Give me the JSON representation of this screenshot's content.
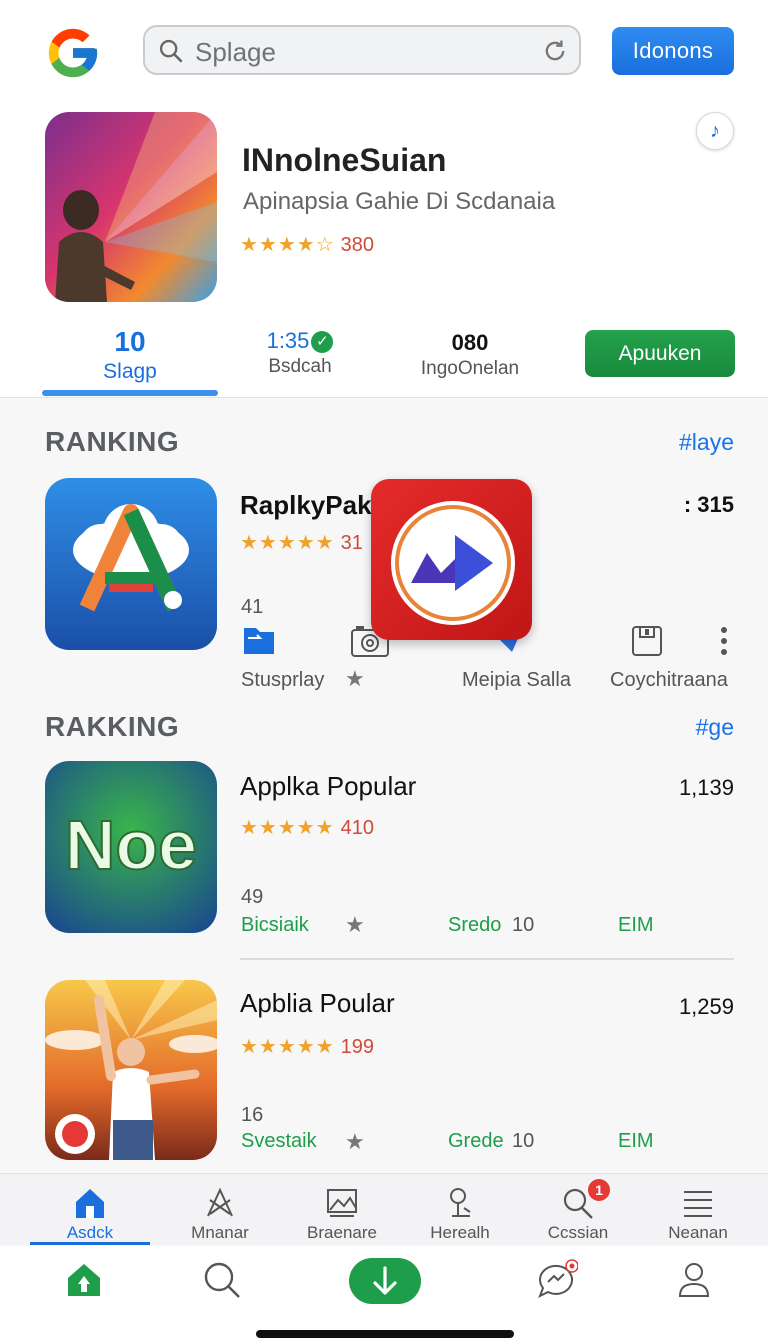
{
  "header": {
    "search_placeholder": "Splage",
    "action_button": "Idonons"
  },
  "featured": {
    "title": "INnolneSuian",
    "subtitle": "Apinapsia Gahie Di Scdanaia",
    "stars": "★★★★☆",
    "rating_count": "380",
    "stats": [
      {
        "value": "10",
        "label": "Slagp"
      },
      {
        "value": "1:35",
        "label": "Bsdcah"
      },
      {
        "value": "080",
        "label": "IngoOnelan"
      }
    ],
    "install_button": "Apuuken",
    "share_icon": "♪"
  },
  "sections": [
    {
      "title": "RANKING",
      "link": "#laye"
    },
    {
      "title": "RAKKING",
      "link": "#ge"
    }
  ],
  "apps": [
    {
      "name": "RaplkyPak",
      "stars": "★★★★★",
      "rating_count": "31",
      "count": ": 315",
      "num": "41",
      "meta": [
        "Stusprlay",
        "Meipia Salla",
        "Coychitraana"
      ]
    },
    {
      "name": "Applka Popular",
      "stars": "★★★★★",
      "rating_count": "410",
      "count": "1,139",
      "num": "49",
      "meta": [
        "Bicsiaik",
        "Sredo",
        "10",
        "EIM"
      ]
    },
    {
      "name": "Apblia Poular",
      "stars": "★★★★★",
      "rating_count": "199",
      "count": "1,259",
      "num": "16",
      "meta": [
        "Svestaik",
        "Grede",
        "10",
        "EIM"
      ]
    }
  ],
  "tabs": [
    {
      "label": "Asdck",
      "icon": "home-icon"
    },
    {
      "label": "Mnanar",
      "icon": "compass-icon"
    },
    {
      "label": "Braenare",
      "icon": "browse-icon"
    },
    {
      "label": "Herealh",
      "icon": "person-pin-icon"
    },
    {
      "label": "Ccssian",
      "icon": "search-icon"
    },
    {
      "label": "Neanan",
      "icon": "list-icon"
    }
  ],
  "notification_badge": "1",
  "colors": {
    "accent_blue": "#1a6fdc",
    "accent_green": "#1e9e4a",
    "star": "#f0a32a"
  }
}
